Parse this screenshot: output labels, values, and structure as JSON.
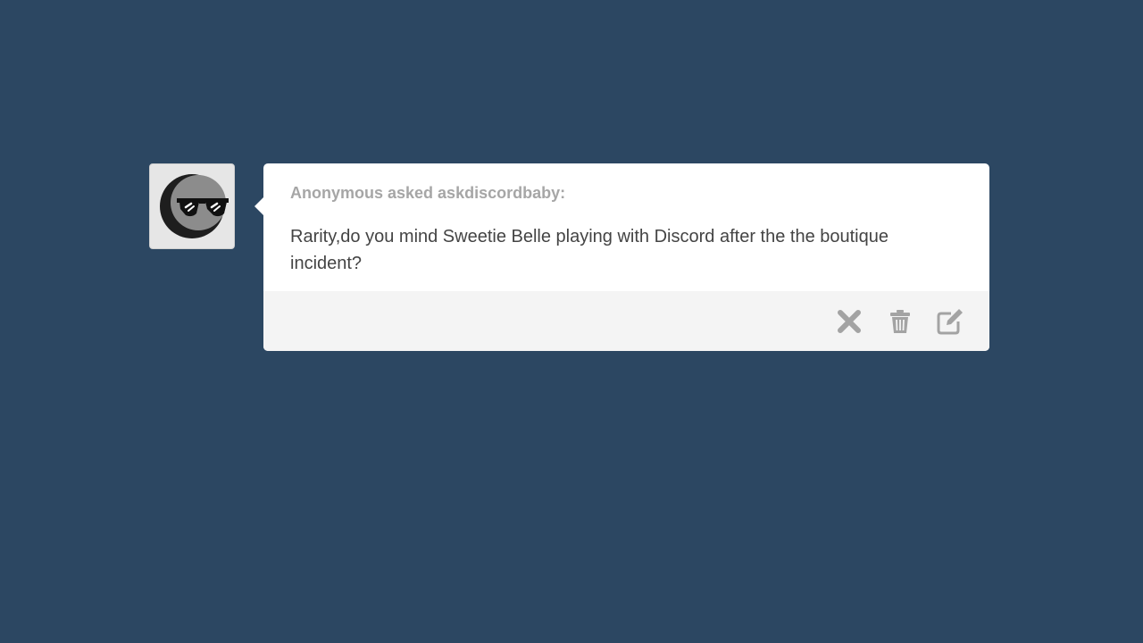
{
  "avatar": {
    "icon": "sunglasses-moon-icon"
  },
  "ask": {
    "asker_line": "Anonymous asked askdiscordbaby:",
    "question": "Rarity,do you mind Sweetie Belle playing with Discord after the the boutique incident?"
  },
  "actions": [
    {
      "name": "ignore",
      "icon": "close-x-icon"
    },
    {
      "name": "delete",
      "icon": "trash-icon"
    },
    {
      "name": "answer",
      "icon": "edit-icon"
    }
  ],
  "colors": {
    "background": "#2c4762",
    "card": "#ffffff",
    "footer": "#f4f4f4",
    "asker_text": "#a6a6a6",
    "question_text": "#444444",
    "icon": "#a3a3a3"
  }
}
